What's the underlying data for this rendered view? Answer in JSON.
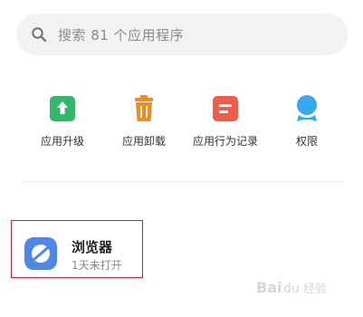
{
  "search": {
    "placeholder": "搜索 81 个应用程序",
    "icon": "search-icon"
  },
  "quick_actions": [
    {
      "label": "应用升级",
      "icon": "upgrade-icon",
      "color": "#33b86b"
    },
    {
      "label": "应用卸载",
      "icon": "trash-icon",
      "color": "#f08c1f"
    },
    {
      "label": "应用行为记录",
      "icon": "record-icon",
      "color": "#ee5c4a"
    },
    {
      "label": "权限",
      "icon": "permission-icon",
      "color": "#37a8f0"
    }
  ],
  "app": {
    "name": "浏览器",
    "status": "1天未打开",
    "icon": "browser-icon",
    "icon_color": "#4f87e6"
  },
  "watermark": {
    "text": "Baidu经验"
  },
  "colors": {
    "highlight_border": "#c7242b",
    "search_bg": "#f2f2f2"
  }
}
